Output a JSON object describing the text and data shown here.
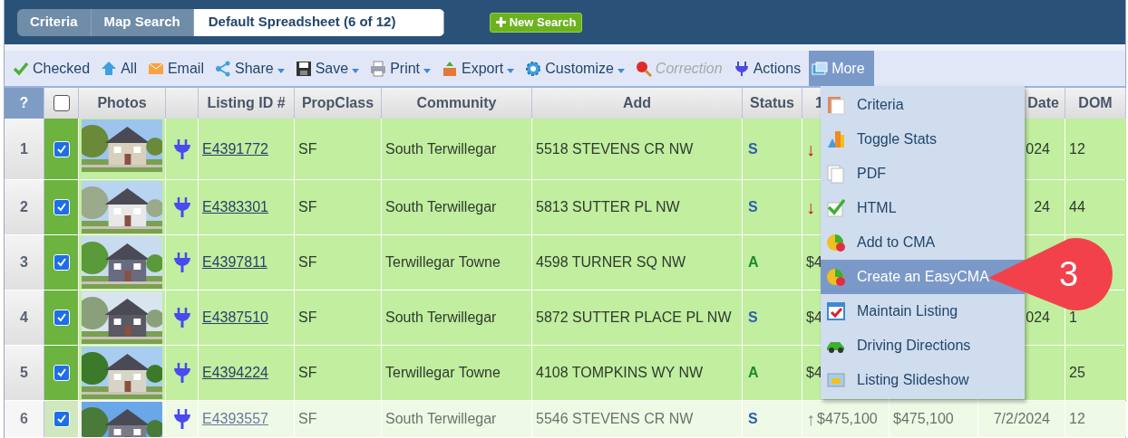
{
  "tabs": [
    {
      "label": "Criteria",
      "selected": false
    },
    {
      "label": "Map Search",
      "selected": false
    },
    {
      "label": "Default Spreadsheet (6 of 12)",
      "selected": true
    }
  ],
  "new_search_button": {
    "label": "New Search"
  },
  "toolbar": [
    {
      "kind": "checked",
      "label": "Checked",
      "dropdown": false,
      "disabled": false,
      "selected": false
    },
    {
      "kind": "all",
      "label": "All",
      "dropdown": false,
      "disabled": false,
      "selected": false
    },
    {
      "kind": "email",
      "label": "Email",
      "dropdown": false,
      "disabled": false,
      "selected": false
    },
    {
      "kind": "share",
      "label": "Share",
      "dropdown": true,
      "disabled": false,
      "selected": false
    },
    {
      "kind": "save",
      "label": "Save",
      "dropdown": true,
      "disabled": false,
      "selected": false
    },
    {
      "kind": "print",
      "label": "Print",
      "dropdown": true,
      "disabled": false,
      "selected": false
    },
    {
      "kind": "export",
      "label": "Export",
      "dropdown": true,
      "disabled": false,
      "selected": false
    },
    {
      "kind": "customize",
      "label": "Customize",
      "dropdown": true,
      "disabled": false,
      "selected": false
    },
    {
      "kind": "correction",
      "label": "Correction",
      "dropdown": false,
      "disabled": true,
      "selected": false
    },
    {
      "kind": "actions",
      "label": "Actions",
      "dropdown": false,
      "disabled": false,
      "selected": false
    },
    {
      "kind": "more",
      "label": "More",
      "dropdown": false,
      "disabled": false,
      "selected": true
    }
  ],
  "table": {
    "columns": [
      {
        "kind": "index",
        "label": "?"
      },
      {
        "kind": "checkbox",
        "checked": false
      },
      {
        "kind": "text",
        "label": "Photos"
      },
      {
        "kind": "blank"
      },
      {
        "kind": "text",
        "label": "Listing ID #"
      },
      {
        "kind": "text",
        "label": "PropClass"
      },
      {
        "kind": "text",
        "label": "Community"
      },
      {
        "kind": "text",
        "label": "Add"
      },
      {
        "kind": "text",
        "label": "Status"
      },
      {
        "kind": "text",
        "label": "1"
      },
      {
        "kind": "blank"
      },
      {
        "kind": "right",
        "label": "Date"
      },
      {
        "kind": "text",
        "label": "DOM"
      }
    ],
    "rows": [
      {
        "number": "1",
        "checked": true,
        "faded": false,
        "listing_id": "E4391772",
        "prop_class": "SF",
        "community": "South Terwillegar",
        "address": "5518 STEVENS CR NW",
        "status": "S",
        "color": "#2f5fb3",
        "arrow": "↓",
        "date": "024",
        "dom": "12"
      },
      {
        "number": "2",
        "checked": true,
        "faded": false,
        "listing_id": "E4383301",
        "prop_class": "SF",
        "community": "South Terwillegar",
        "address": "5813 SUTTER PL NW",
        "status": "S",
        "color": "#2f5fb3",
        "arrow": "↓",
        "date": "24",
        "dom": "44"
      },
      {
        "number": "3",
        "checked": true,
        "faded": false,
        "listing_id": "E4397811",
        "prop_class": "SF",
        "community": "Terwillegar Towne",
        "address": "4598 TURNER SQ NW",
        "status": "A",
        "color": "#1e8a2e",
        "price": "$4"
      },
      {
        "number": "4",
        "checked": true,
        "faded": false,
        "listing_id": "E4387510",
        "prop_class": "SF",
        "community": "South Terwillegar",
        "address": "5872 SUTTER PLACE PL NW",
        "status": "S",
        "color": "#2f5fb3",
        "price": "$4",
        "date": "024",
        "dom": "1"
      },
      {
        "number": "5",
        "checked": true,
        "faded": false,
        "listing_id": "E4394224",
        "prop_class": "SF",
        "community": "Terwillegar Towne",
        "address": "4108 TOMPKINS WY NW",
        "status": "A",
        "color": "#1e8a2e",
        "price": "$4",
        "dom": "25"
      },
      {
        "number": "6",
        "checked": true,
        "faded": true,
        "listing_id": "E4393557",
        "prop_class": "SF",
        "community": "South Terwillegar",
        "address": "5546 STEVENS CR NW",
        "status": "S",
        "color": "#2f5fb3",
        "arrow": "↑",
        "price": "$475,100",
        "column_10": "$475,100",
        "date": "7/2/2024",
        "dom": "12"
      }
    ]
  },
  "more_menu": [
    {
      "kind": "criteria",
      "label": "Criteria",
      "selected": false
    },
    {
      "kind": "stats",
      "label": "Toggle Stats",
      "selected": false
    },
    {
      "kind": "pdf",
      "label": "PDF",
      "selected": false
    },
    {
      "kind": "html",
      "label": "HTML",
      "selected": false
    },
    {
      "kind": "cma",
      "label": "Add to CMA",
      "selected": false
    },
    {
      "kind": "cma",
      "label": "Create an EasyCMA",
      "selected": true
    },
    {
      "kind": "maintain",
      "label": "Maintain Listing",
      "selected": false
    },
    {
      "kind": "directions",
      "label": "Driving Directions",
      "selected": false
    },
    {
      "kind": "slideshow",
      "label": "Listing Slideshow",
      "selected": false
    }
  ],
  "callout": {
    "label": "3"
  }
}
